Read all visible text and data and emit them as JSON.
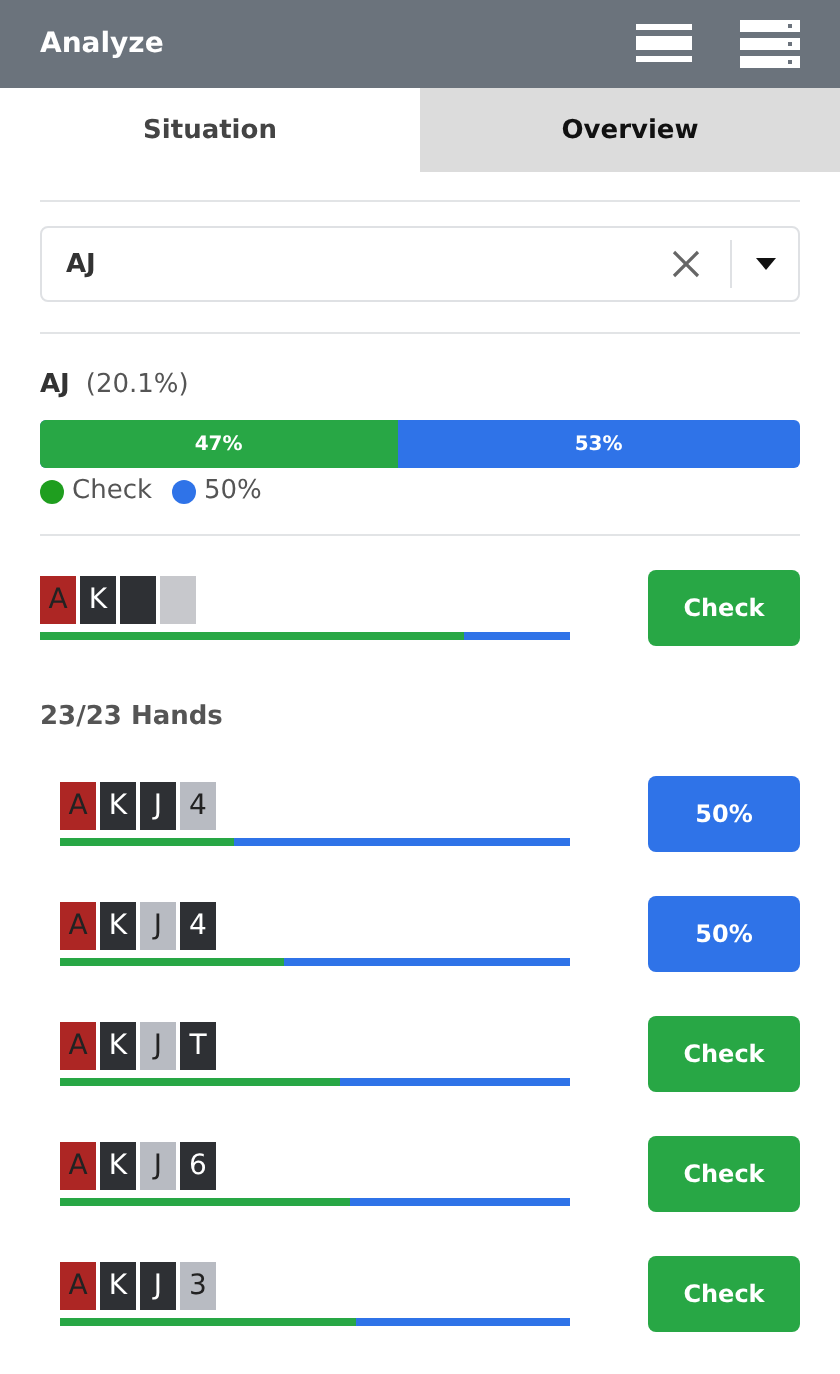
{
  "header": {
    "title": "Analyze"
  },
  "tabs": [
    {
      "label": "Situation",
      "selected": true
    },
    {
      "label": "Overview",
      "selected": false
    }
  ],
  "filter": {
    "value": "AJ"
  },
  "summary": {
    "hand": "AJ",
    "share": "(20.1%)",
    "segments": [
      {
        "label": "47%",
        "level": 0.47,
        "color": "#28a745"
      },
      {
        "label": "53%",
        "color": "#2f73e8"
      }
    ],
    "legend": [
      {
        "label": "Check",
        "color": "#1f9e1f"
      },
      {
        "label": "50%",
        "color": "#2f73e8"
      }
    ]
  },
  "board": {
    "cards": [
      {
        "rank": "A",
        "color": "#ad2624"
      },
      {
        "rank": "K",
        "color": "#2e3034"
      },
      {
        "color": "#2e3034"
      },
      {
        "color": "#c7c8cc"
      }
    ],
    "level": 0.8,
    "action": {
      "label": "Check",
      "kind": "check"
    }
  },
  "hands_count": "23/23 Hands",
  "hands": [
    {
      "cards": [
        {
          "rank": "A",
          "color": "#ad2624"
        },
        {
          "rank": "K",
          "color": "#2e3034"
        },
        {
          "rank": "J",
          "color": "#2e3034"
        },
        {
          "rank": "4",
          "color": "#b8bbc2"
        }
      ],
      "level": 0.34,
      "action": {
        "label": "50%",
        "kind": "bet"
      }
    },
    {
      "cards": [
        {
          "rank": "A",
          "color": "#ad2624"
        },
        {
          "rank": "K",
          "color": "#2e3034"
        },
        {
          "rank": "J",
          "color": "#b8bbc2"
        },
        {
          "rank": "4",
          "color": "#2e3034"
        }
      ],
      "level": 0.44,
      "action": {
        "label": "50%",
        "kind": "bet"
      }
    },
    {
      "cards": [
        {
          "rank": "A",
          "color": "#ad2624"
        },
        {
          "rank": "K",
          "color": "#2e3034"
        },
        {
          "rank": "J",
          "color": "#b8bbc2"
        },
        {
          "rank": "T",
          "color": "#2e3034"
        }
      ],
      "level": 0.55,
      "action": {
        "label": "Check",
        "kind": "check"
      }
    },
    {
      "cards": [
        {
          "rank": "A",
          "color": "#ad2624"
        },
        {
          "rank": "K",
          "color": "#2e3034"
        },
        {
          "rank": "J",
          "color": "#b8bbc2"
        },
        {
          "rank": "6",
          "color": "#2e3034"
        }
      ],
      "level": 0.57,
      "action": {
        "label": "Check",
        "kind": "check"
      }
    },
    {
      "cards": [
        {
          "rank": "A",
          "color": "#ad2624"
        },
        {
          "rank": "K",
          "color": "#2e3034"
        },
        {
          "rank": "J",
          "color": "#2e3034"
        },
        {
          "rank": "3",
          "color": "#b8bbc2"
        }
      ],
      "level": 0.58,
      "action": {
        "label": "Check",
        "kind": "check"
      }
    }
  ]
}
